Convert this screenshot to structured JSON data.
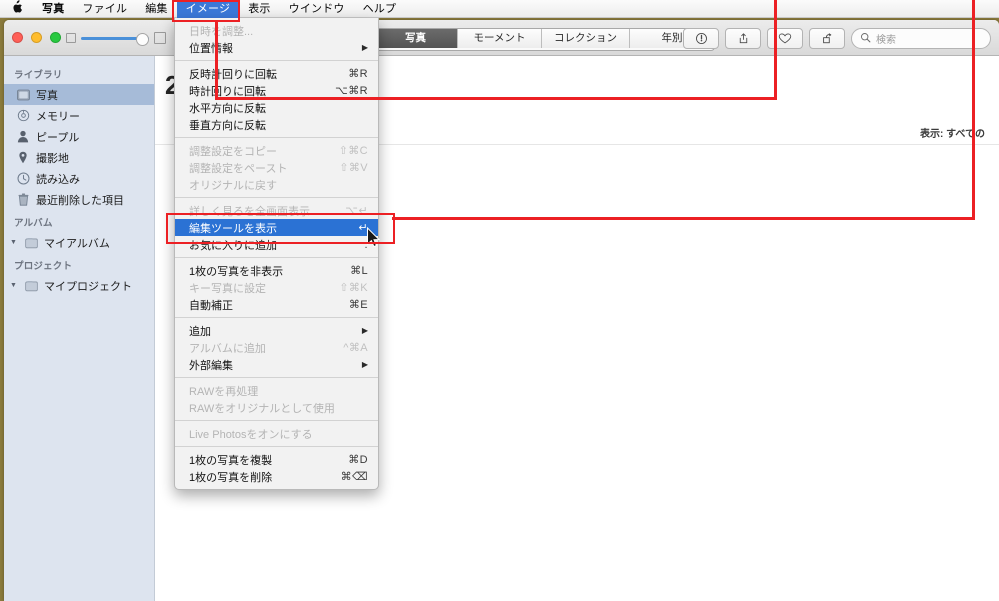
{
  "menubar": {
    "apple_icon": "apple-logo",
    "items": [
      {
        "label": "写真",
        "bold": true,
        "active": false
      },
      {
        "label": "ファイル",
        "bold": false,
        "active": false
      },
      {
        "label": "編集",
        "bold": false,
        "active": false
      },
      {
        "label": "イメージ",
        "bold": false,
        "active": true
      },
      {
        "label": "表示",
        "bold": false,
        "active": false
      },
      {
        "label": "ウインドウ",
        "bold": false,
        "active": false
      },
      {
        "label": "ヘルプ",
        "bold": false,
        "active": false
      }
    ]
  },
  "toolbar": {
    "segmented": [
      {
        "label": "写真",
        "active": true
      },
      {
        "label": "モーメント",
        "active": false
      },
      {
        "label": "コレクション",
        "active": false
      },
      {
        "label": "年別",
        "active": false
      }
    ],
    "buttons": [
      {
        "name": "info-icon",
        "title": "情報"
      },
      {
        "name": "share-icon",
        "title": "共有"
      },
      {
        "name": "favorite-heart-icon",
        "title": "お気に入り"
      },
      {
        "name": "rotate-icon",
        "title": "回転"
      }
    ],
    "search_placeholder": "検索"
  },
  "sidebar": {
    "sections": [
      {
        "header": "ライブラリ",
        "items": [
          {
            "label": "写真",
            "icon": "photos-icon",
            "selected": true
          },
          {
            "label": "メモリー",
            "icon": "memories-icon",
            "selected": false
          },
          {
            "label": "ピープル",
            "icon": "people-icon",
            "selected": false
          },
          {
            "label": "撮影地",
            "icon": "places-pin-icon",
            "selected": false
          },
          {
            "label": "読み込み",
            "icon": "import-clock-icon",
            "selected": false
          },
          {
            "label": "最近削除した項目",
            "icon": "trash-icon",
            "selected": false
          }
        ]
      },
      {
        "header": "アルバム",
        "items": [
          {
            "label": "マイアルバム",
            "icon": "folder-icon",
            "selected": false,
            "disclosure": true
          }
        ]
      },
      {
        "header": "プロジェクト",
        "items": [
          {
            "label": "マイプロジェクト",
            "icon": "folder-icon",
            "selected": false,
            "disclosure": true
          }
        ]
      }
    ]
  },
  "content": {
    "year": "2",
    "subtitle": "",
    "filter_label": "表示: すべての"
  },
  "image_menu": {
    "title": "イメージ",
    "items": [
      {
        "label": "日時を調整...",
        "key": "",
        "disabled": true,
        "submenu": false,
        "highlight": false
      },
      {
        "label": "位置情報",
        "key": "",
        "disabled": false,
        "submenu": true,
        "highlight": false
      },
      {
        "separator": true
      },
      {
        "label": "反時計回りに回転",
        "key": "⌘R",
        "disabled": false,
        "submenu": false,
        "highlight": false
      },
      {
        "label": "時計回りに回転",
        "key": "⌥⌘R",
        "disabled": false,
        "submenu": false,
        "highlight": false
      },
      {
        "label": "水平方向に反転",
        "key": "",
        "disabled": false,
        "submenu": false,
        "highlight": false
      },
      {
        "label": "垂直方向に反転",
        "key": "",
        "disabled": false,
        "submenu": false,
        "highlight": false
      },
      {
        "separator": true
      },
      {
        "label": "調整設定をコピー",
        "key": "⇧⌘C",
        "disabled": true,
        "submenu": false,
        "highlight": false
      },
      {
        "label": "調整設定をペースト",
        "key": "⇧⌘V",
        "disabled": true,
        "submenu": false,
        "highlight": false
      },
      {
        "label": "オリジナルに戻す",
        "key": "",
        "disabled": true,
        "submenu": false,
        "highlight": false
      },
      {
        "separator": true
      },
      {
        "label": "詳しく見るを全画面表示",
        "key": "⌥↵",
        "disabled": true,
        "submenu": false,
        "highlight": false
      },
      {
        "label": "編集ツールを表示",
        "key": "↵",
        "disabled": false,
        "submenu": false,
        "highlight": true
      },
      {
        "label": "お気に入りに追加",
        "key": ".",
        "disabled": false,
        "submenu": false,
        "highlight": false
      },
      {
        "separator": true
      },
      {
        "label": "1枚の写真を非表示",
        "key": "⌘L",
        "disabled": false,
        "submenu": false,
        "highlight": false
      },
      {
        "label": "キー写真に設定",
        "key": "⇧⌘K",
        "disabled": true,
        "submenu": false,
        "highlight": false
      },
      {
        "label": "自動補正",
        "key": "⌘E",
        "disabled": false,
        "submenu": false,
        "highlight": false
      },
      {
        "separator": true
      },
      {
        "label": "追加",
        "key": "",
        "disabled": false,
        "submenu": true,
        "highlight": false
      },
      {
        "label": "アルバムに追加",
        "key": "^⌘A",
        "disabled": true,
        "submenu": false,
        "highlight": false
      },
      {
        "label": "外部編集",
        "key": "",
        "disabled": false,
        "submenu": true,
        "highlight": false
      },
      {
        "separator": true
      },
      {
        "label": "RAWを再処理",
        "key": "",
        "disabled": true,
        "submenu": false,
        "highlight": false
      },
      {
        "label": "RAWをオリジナルとして使用",
        "key": "",
        "disabled": true,
        "submenu": false,
        "highlight": false
      },
      {
        "separator": true
      },
      {
        "label": "Live Photosをオンにする",
        "key": "",
        "disabled": true,
        "submenu": false,
        "highlight": false
      },
      {
        "separator": true
      },
      {
        "label": "1枚の写真を複製",
        "key": "⌘D",
        "disabled": false,
        "submenu": false,
        "highlight": false
      },
      {
        "label": "1枚の写真を削除",
        "key": "⌘⌫",
        "disabled": false,
        "submenu": false,
        "highlight": false
      }
    ]
  },
  "annotations": {
    "accent_color": "#ec2024",
    "boxes": [
      {
        "name": "image-menu-highlight-box"
      },
      {
        "name": "show-edit-tools-highlight-box"
      }
    ]
  }
}
